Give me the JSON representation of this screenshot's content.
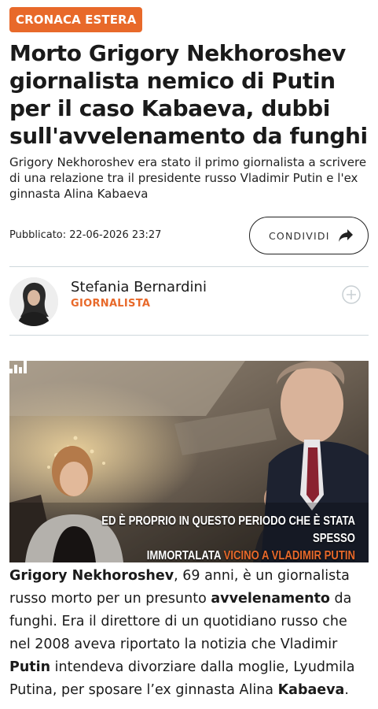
{
  "category": "CRONACA ESTERA",
  "headline": "Morto Grigory Nekhoroshev giornalista nemico di Putin per il caso Kabaeva, dubbi sull'avvelenamento da funghi",
  "subtitle": "Grigory Nekhoroshev era stato il primo giornalista a scrivere di una relazione tra il presidente russo Vladimir Putin e l'ex ginnasta Alina Kabaeva",
  "published": "Pubblicato: 22-06-2026 23:27",
  "share": {
    "label": "CONDIVIDI",
    "icon": "share-arrow-icon"
  },
  "author": {
    "name": "Stefania Bernardini",
    "role": "GIORNALISTA",
    "follow_icon": "plus-circle-icon"
  },
  "hero": {
    "caption_line1": "ED È PROPRIO IN QUESTO PERIODO CHE È STATA SPESSO",
    "caption_line2_plain": "IMMORTALATA ",
    "caption_line2_highlight": "VICINO A VLADIMIR PUTIN",
    "watermark_icon": "bars-logo-icon"
  },
  "body": {
    "p1_bold_name": "Grigory Nekhoroshev",
    "p1_a": ", 69 anni, è un giornalista russo morto per un presunto ",
    "p1_bold_poison": "avvelenamento",
    "p1_b": " da funghi. Era il direttore di un quotidiano russo che nel 2008 aveva riportato la notizia che Vladimir ",
    "p1_bold_putin": "Putin",
    "p1_c": " intendeva divorziare dalla moglie, Lyudmila Putina, per sposare l’ex ginnasta Alina ",
    "p1_bold_kabaeva": "Kabaeva",
    "p1_d": "."
  },
  "colors": {
    "accent": "#e8692a",
    "divider": "#cfd8dc",
    "text": "#1a1a1a"
  }
}
